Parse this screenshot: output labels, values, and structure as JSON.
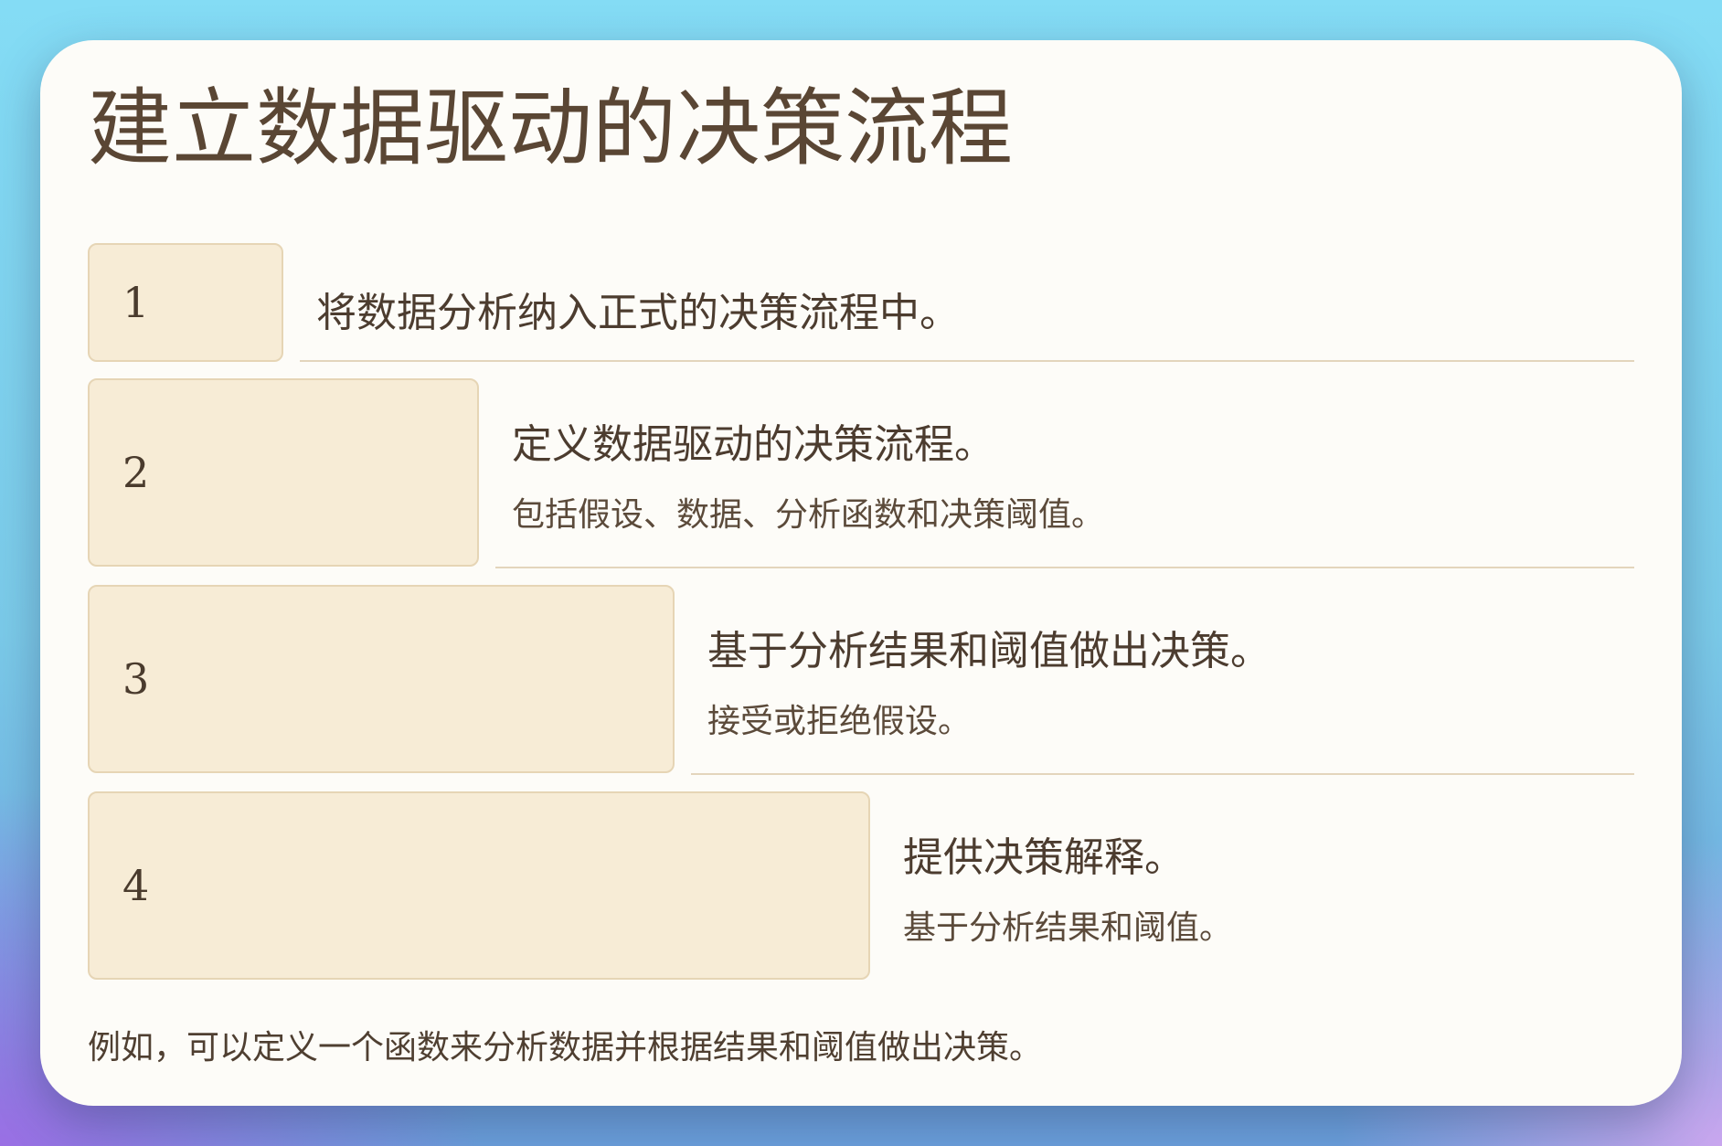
{
  "title": "建立数据驱动的决策流程",
  "steps": [
    {
      "number": "1",
      "title": "将数据分析纳入正式的决策流程中。",
      "subtitle": ""
    },
    {
      "number": "2",
      "title": "定义数据驱动的决策流程。",
      "subtitle": "包括假设、数据、分析函数和决策阈值。"
    },
    {
      "number": "3",
      "title": "基于分析结果和阈值做出决策。",
      "subtitle": "接受或拒绝假设。"
    },
    {
      "number": "4",
      "title": "提供决策解释。",
      "subtitle": "基于分析结果和阈值。"
    }
  ],
  "footer": "例如，可以定义一个函数来分析数据并根据结果和阈值做出决策。",
  "colors": {
    "card_background": "#fdfcf8",
    "step_box_fill": "#f7ecd6",
    "step_box_border": "#e6d5b5",
    "title_text": "#5a4634",
    "divider": "#e3d5bc"
  }
}
